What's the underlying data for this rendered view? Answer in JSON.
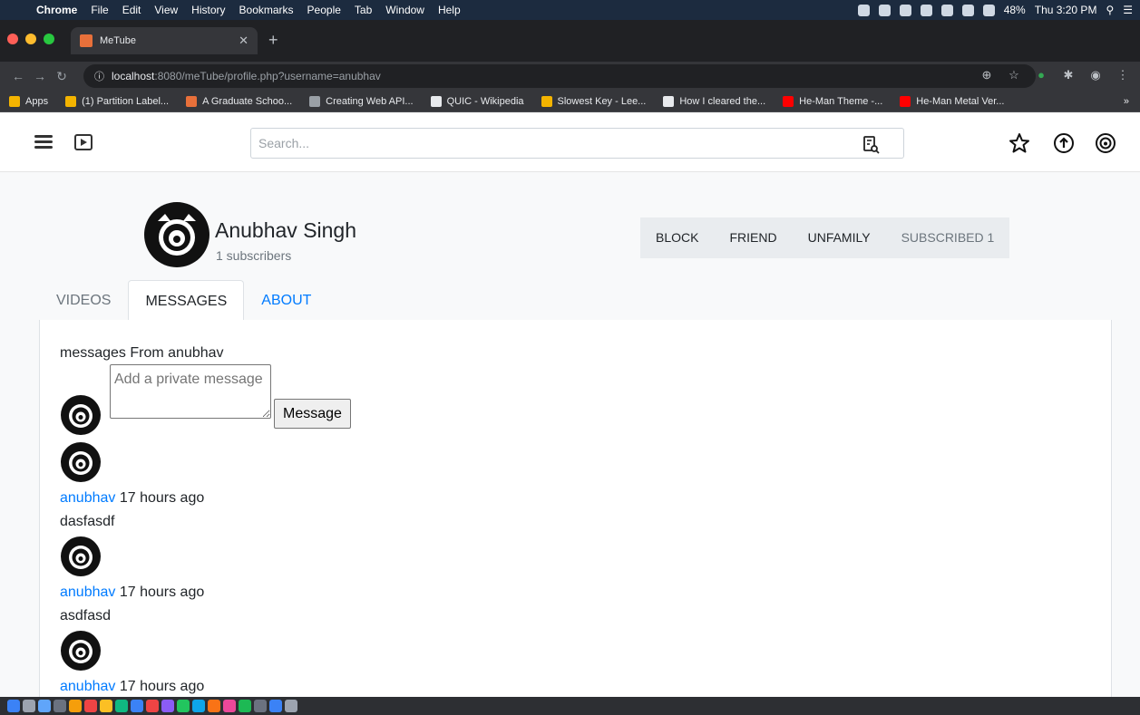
{
  "os_menu": {
    "app": "Chrome",
    "items": [
      "File",
      "Edit",
      "View",
      "History",
      "Bookmarks",
      "People",
      "Tab",
      "Window",
      "Help"
    ],
    "battery": "48%",
    "clock": "Thu 3:20 PM"
  },
  "browser": {
    "tab_title": "MeTube",
    "url_host": "localhost",
    "url_rest": ":8080/meTube/profile.php?username=anubhav",
    "bookmarks": [
      {
        "label": "Apps",
        "color": "#f4b400"
      },
      {
        "label": "(1) Partition Label...",
        "color": "#f4b400"
      },
      {
        "label": "A Graduate Schoo...",
        "color": "#e8703a"
      },
      {
        "label": "Creating Web API...",
        "color": "#9aa0a6"
      },
      {
        "label": "QUIC - Wikipedia",
        "color": "#e8eaed"
      },
      {
        "label": "Slowest Key - Lee...",
        "color": "#f4b400"
      },
      {
        "label": "How I cleared the...",
        "color": "#e8eaed"
      },
      {
        "label": "He-Man Theme -...",
        "color": "#ff0000"
      },
      {
        "label": "He-Man Metal Ver...",
        "color": "#ff0000"
      }
    ],
    "bookmarks_more": "»"
  },
  "navbar": {
    "search_placeholder": "Search..."
  },
  "profile": {
    "name": "Anubhav Singh",
    "subscribers": "1 subscribers",
    "actions": [
      "BLOCK",
      "FRIEND",
      "UNFAMILY",
      "SUBSCRIBED 1"
    ]
  },
  "tabs": [
    "VIDEOS",
    "MESSAGES",
    "ABOUT"
  ],
  "messages": {
    "heading": "messages From anubhav",
    "compose_placeholder": "Add a private message",
    "send_label": "Message",
    "list": [
      {
        "user": "anubhav",
        "time": "17 hours ago",
        "text": "dasfasdf"
      },
      {
        "user": "anubhav",
        "time": "17 hours ago",
        "text": "asdfasd"
      },
      {
        "user": "anubhav",
        "time": "17 hours ago",
        "text": ""
      }
    ]
  },
  "colors": {
    "link": "#007bff",
    "muted": "#6c757d",
    "button_group_bg": "#e9ecef"
  }
}
